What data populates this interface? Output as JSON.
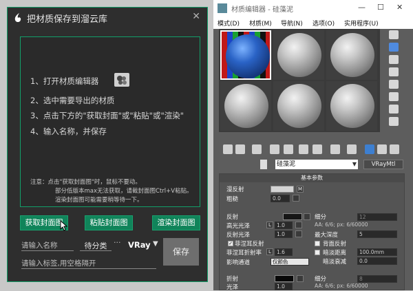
{
  "dialog": {
    "title": "把材质保存到溜云库",
    "close": "✕",
    "steps": [
      "1、打开材质编辑器",
      "2、选中需要导出的材质",
      "3、点击下方的\"获取封面\"或\"粘贴\"或\"渲染\"",
      "4、输入名称，并保存"
    ],
    "note_lines": [
      "注意：点击\"获取封面图\"时，鼠标不要动。",
      "部分低版本max无法获取，请截封面图Ctrl+V粘贴。",
      "渲染封面图可能需要稍等待一下。"
    ],
    "buttons": {
      "get_cover": "获取封面图",
      "paste_cover": "粘贴封面图",
      "render_cover": "渲染封面图",
      "save": "保存"
    },
    "name_placeholder": "请输入名称",
    "category": "待分类",
    "dots": "···",
    "renderer": "VRay",
    "renderer_caret": "▼",
    "tags_placeholder": "请输入标签,用空格隔开",
    "colors": {
      "accent": "#12a06a",
      "button": "#10845a",
      "bg": "#2e2e2e"
    }
  },
  "material_editor": {
    "title": "材质编辑器 - 硅藻泥",
    "window_controls": {
      "minimize": "—",
      "maximize": "☐",
      "close": "✕"
    },
    "menu": [
      "模式(D)",
      "材质(M)",
      "导航(N)",
      "选项(O)",
      "实用程序(U)"
    ],
    "material_name": "硅藻泥",
    "material_type": "VRayMtl",
    "params_title": "基本参数",
    "params": {
      "diffuse": "漫反射",
      "roughness": "粗糙",
      "roughness_val": "0.0",
      "reflect": "反射",
      "hilight_gloss": "高光光泽",
      "hilight_val": "1.0",
      "refl_gloss": "反射光泽",
      "refl_val": "1.0",
      "fresnel": "菲涅耳反射",
      "fresnel_ior": "菲涅耳折射率",
      "fresnel_ior_val": "1.6",
      "affect_channels": "影响通道",
      "affect_channels_val": "仅颜色",
      "subdivs": "细分",
      "subdivs_val": "12",
      "aa_text": "AA: 6/6; px: 6/60000",
      "max_depth": "最大深度",
      "max_depth_val": "5",
      "back_reflect": "背面反射",
      "dim_distance": "暗淡距离",
      "dim_distance_val": "100.0mm",
      "dim_falloff": "暗淡衰减",
      "dim_falloff_val": "0.0",
      "refract": "折射",
      "gloss": "光泽",
      "gloss_val": "1.0",
      "subdivs2": "细分",
      "subdivs2_val": "8",
      "aa_text2": "AA: 6/6; px: 6/60000",
      "m_label": "M",
      "l_label": "L",
      "check": "✓"
    }
  }
}
